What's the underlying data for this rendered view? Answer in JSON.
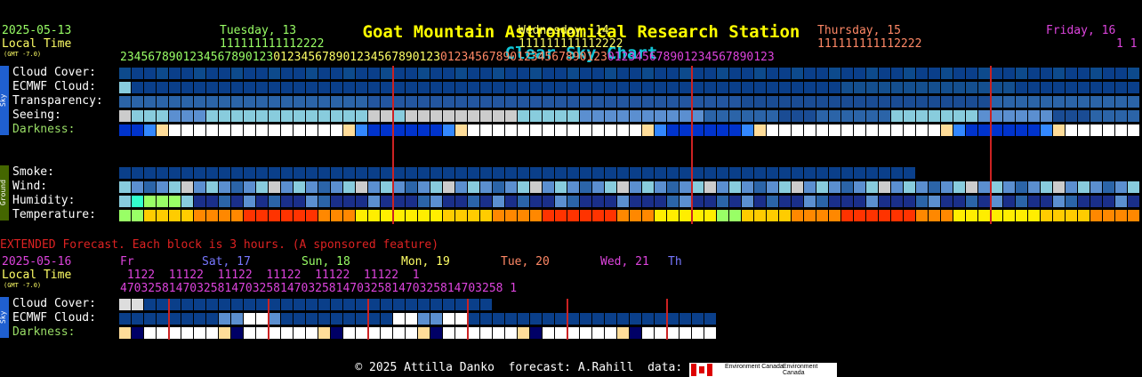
{
  "title": {
    "main": "Goat Mountain Astronomical Research Station",
    "suffix": "Clear Sky Chart"
  },
  "header": {
    "date": "2025-05-13",
    "local_time": "Local Time",
    "gmt": "(GMT -7.0)"
  },
  "days": [
    {
      "label": "Tuesday, 13",
      "color": "#99ff66"
    },
    {
      "label": "Wednesday, 14",
      "color": "#ffff66"
    },
    {
      "label": "Thursday, 15",
      "color": "#ff8866"
    },
    {
      "label": "Friday, 16",
      "color": "#dd44dd"
    }
  ],
  "hours_tens": "111111111112222",
  "hours": "234567890123456789012301234567890123456789012301234567890123456789012301234567890123456789012301",
  "sky_section_label": "Sky",
  "ground_section_label": "Ground",
  "rows": [
    {
      "label": "Cloud Cover:"
    },
    {
      "label": "ECMWF Cloud:"
    },
    {
      "label": "Transparency:"
    },
    {
      "label": "Seeing:"
    },
    {
      "label": "Darkness:"
    }
  ],
  "ground_rows": [
    {
      "label": "Smoke:"
    },
    {
      "label": "Wind:"
    },
    {
      "label": "Humidity:"
    },
    {
      "label": "Temperature:"
    }
  ],
  "extended": {
    "notice": "EXTENDED Forecast. Each block is 3 hours. (A sponsored feature)",
    "date": "2025-05-16",
    "local_time": "Local Time",
    "gmt": "(GMT -7.0)",
    "days": [
      {
        "label": "Fr",
        "color": "#dd44dd"
      },
      {
        "label": "Sat, 17",
        "color": "#7777ff"
      },
      {
        "label": "Sun, 18",
        "color": "#99ff66"
      },
      {
        "label": "Mon, 19",
        "color": "#ffff66"
      },
      {
        "label": "Tue, 20",
        "color": "#ff8866"
      },
      {
        "label": "Wed, 21",
        "color": "#dd44dd"
      },
      {
        "label": "Th",
        "color": "#7777ff"
      }
    ],
    "hours_tens": " 1122  11122  11122  11122  11122  11122  1",
    "hours": "4703258147032581470325814703258147032581470325814703258 1",
    "rows": [
      {
        "label": "Cloud Cover:"
      },
      {
        "label": "ECMWF Cloud:"
      },
      {
        "label": "Darkness:"
      }
    ],
    "sky_label": "Sky"
  },
  "colors": {
    "clear_blue": "#0a3f8a",
    "mid_blue": "#2b64a8",
    "light_blue": "#5b8fd0",
    "cyan": "#88ccdd",
    "grey": "#cccccc",
    "white": "#ffffff",
    "darkness_dark": "#000066",
    "yellow": "#ffee00",
    "orange": "#ff8800",
    "red": "#ff3300",
    "green": "#99ff66",
    "midnight_line": "#cc2222"
  },
  "footer": {
    "copyright": "© 2025 Attilla Danko  forecast: A.Rahill  data:",
    "data_source": "Environment Canada"
  }
}
